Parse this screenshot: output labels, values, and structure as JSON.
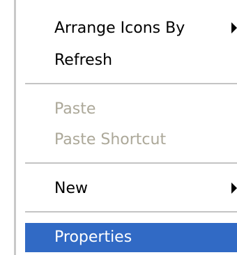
{
  "menu": {
    "items": [
      {
        "label": "Arrange Icons By",
        "enabled": true,
        "has_submenu": true
      },
      {
        "label": "Refresh",
        "enabled": true,
        "has_submenu": false
      },
      {
        "label": "Paste",
        "enabled": false,
        "has_submenu": false
      },
      {
        "label": "Paste Shortcut",
        "enabled": false,
        "has_submenu": false
      },
      {
        "label": "New",
        "enabled": true,
        "has_submenu": true
      },
      {
        "label": "Properties",
        "enabled": true,
        "has_submenu": false,
        "selected": true
      }
    ]
  },
  "colors": {
    "selection_bg": "#316ac5",
    "selection_text": "#ffffff",
    "disabled_text": "#aca899",
    "text": "#000000",
    "separator": "#c4c4c4"
  }
}
